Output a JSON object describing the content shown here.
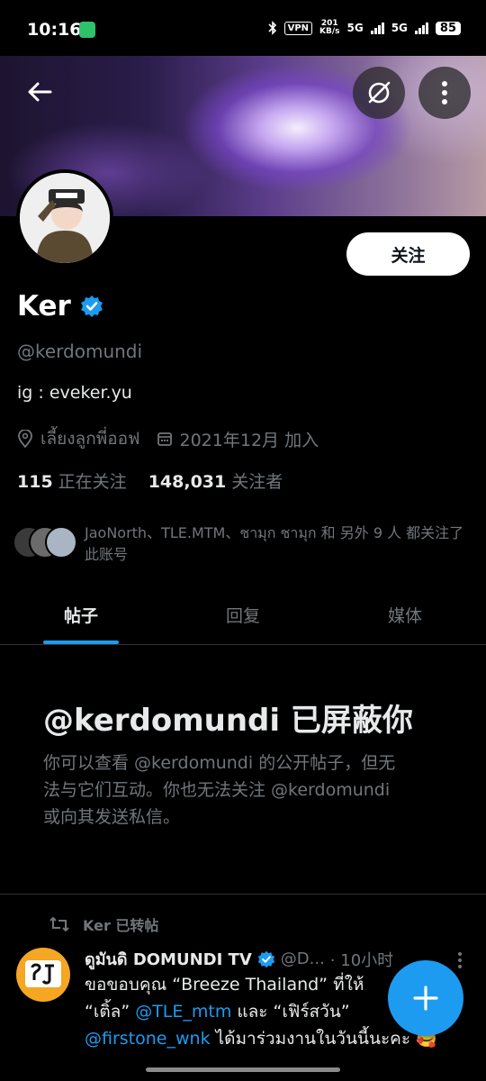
{
  "status_bar": {
    "time": "10:16",
    "vpn": "VPN",
    "speed_value": "201",
    "speed_unit": "KB/s",
    "net1": "5G",
    "net2": "5G",
    "battery": "85"
  },
  "profile": {
    "follow_label": "关注",
    "name": "Ker",
    "handle": "@kerdomundi",
    "bio": "ig : eveker.yu",
    "location": "เลี้ยงลูกพี่ออฟ",
    "joined": "2021年12月 加入",
    "following_count": "115",
    "following_label": "正在关注",
    "followers_count": "148,031",
    "followers_label": "关注者",
    "mutual_text": "JaoNorth、TLE.MTM、ชามุก ชามุก 和 另外 9 人 都关注了此账号"
  },
  "tabs": [
    {
      "label": "帖子"
    },
    {
      "label": "回复"
    },
    {
      "label": "媒体"
    }
  ],
  "blocked": {
    "title": "@kerdomundi 已屏蔽你",
    "description": "你可以查看 @kerdomundi 的公开帖子，但无法与它们互动。你也无法关注 @kerdomundi 或向其发送私信。"
  },
  "tweet": {
    "retweet_label": "Ker 已转帖",
    "author": "ดูมันดิ DOMUNDI TV",
    "handle": "@D...",
    "time": "· 10小时",
    "text_1": "ขอขอบคุณ “Breeze Thailand” ที่ให้",
    "text_2": "“เติ้ล” ",
    "mention_1": "@TLE_mtm",
    "text_3": " และ “เฟิร์สวัน”",
    "mention_2": "@firstone_wnk",
    "text_4": " ได้มาร่วมงานในวันนี้นะคะ 🥰"
  },
  "colors": {
    "accent": "#1d9bf0",
    "background": "#000000",
    "muted_text": "#71767b"
  }
}
